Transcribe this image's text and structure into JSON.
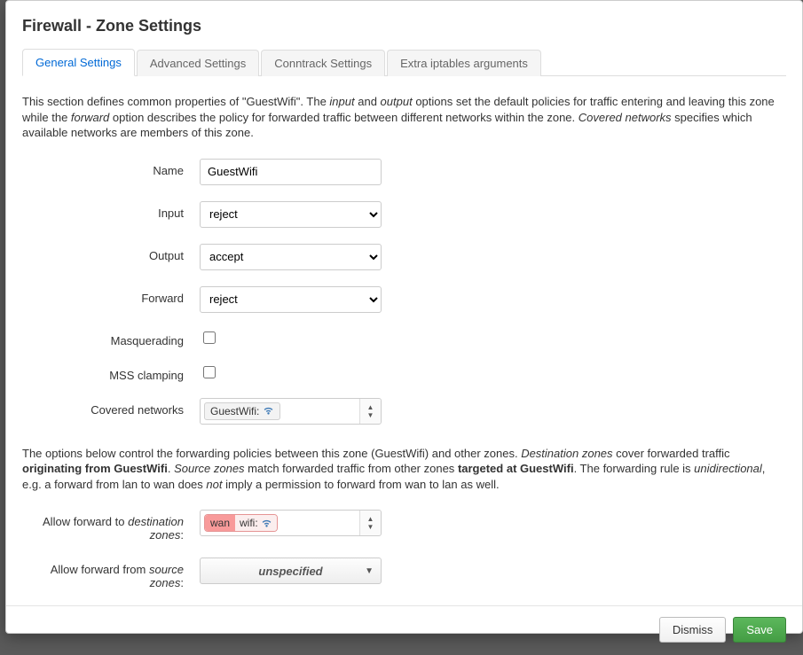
{
  "title": "Firewall - Zone Settings",
  "tabs": [
    {
      "label": "General Settings"
    },
    {
      "label": "Advanced Settings"
    },
    {
      "label": "Conntrack Settings"
    },
    {
      "label": "Extra iptables arguments"
    }
  ],
  "description1": {
    "pre": "This section defines common properties of \"GuestWifi\". The ",
    "input": "input",
    "mid1": " and ",
    "output": "output",
    "mid2": " options set the default policies for traffic entering and leaving this zone while the ",
    "forward": "forward",
    "mid3": " option describes the policy for forwarded traffic between different networks within the zone. ",
    "covered": "Covered networks",
    "post": " specifies which available networks are members of this zone."
  },
  "fields": {
    "name_label": "Name",
    "name_value": "GuestWifi",
    "input_label": "Input",
    "input_value": "reject",
    "output_label": "Output",
    "output_value": "accept",
    "forward_label": "Forward",
    "forward_value": "reject",
    "masq_label": "Masquerading",
    "mss_label": "MSS clamping",
    "covered_label": "Covered networks",
    "covered_pill": "GuestWifi:"
  },
  "description2": {
    "pre": "The options below control the forwarding policies between this zone (GuestWifi) and other zones. ",
    "dest": "Destination zones",
    "mid1": " cover forwarded traffic ",
    "orig": "originating from GuestWifi",
    "mid2": ". ",
    "src": "Source zones",
    "mid3": " match forwarded traffic from other zones ",
    "target": "targeted at GuestWifi",
    "mid4": ". The forwarding rule is ",
    "uni": "unidirectional",
    "mid5": ", e.g. a forward from lan to wan does ",
    "not": "not",
    "post": " imply a permission to forward from wan to lan as well."
  },
  "forward_dest_label_pre": "Allow forward to ",
  "forward_dest_label_em": "destination zones",
  "forward_dest_label_post": ":",
  "forward_dest_wan": "wan",
  "forward_dest_wifi": "wifi:",
  "forward_src_label_pre": "Allow forward from ",
  "forward_src_label_em": "source zones",
  "forward_src_label_post": ":",
  "forward_src_value": "unspecified",
  "buttons": {
    "dismiss": "Dismiss",
    "save": "Save"
  }
}
